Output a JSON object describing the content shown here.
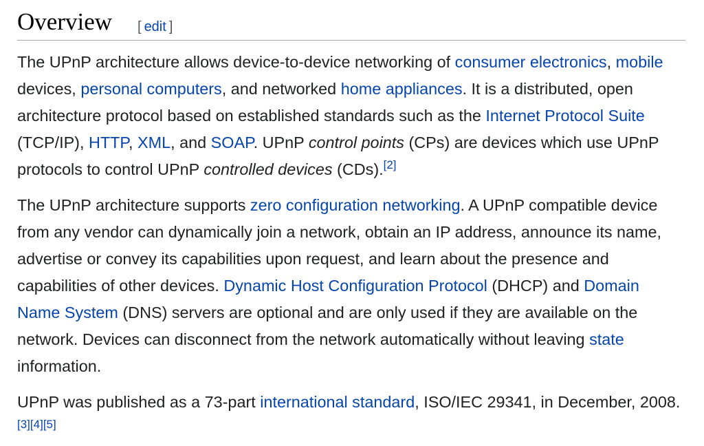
{
  "section": {
    "title": "Overview",
    "edit_bracket_open": "[",
    "edit_label": "edit",
    "edit_bracket_close": "]"
  },
  "paragraphs": {
    "p1": {
      "t1": "The UPnP architecture allows device-to-device networking of ",
      "l1": "consumer electronics",
      "t2": ", ",
      "l2": "mobile",
      "t3": " devices, ",
      "l3": "personal computers",
      "t4": ", and networked ",
      "l4": "home appliances",
      "t5": ". It is a distributed, open architecture protocol based on established standards such as the ",
      "l5": "Internet Protocol Suite",
      "t6": " (TCP/IP), ",
      "l6": "HTTP",
      "t7": ", ",
      "l7": "XML",
      "t8": ", and ",
      "l8": "SOAP",
      "t9": ". UPnP ",
      "i1": "control points",
      "t10": " (CPs) are devices which use UPnP protocols to control UPnP ",
      "i2": "controlled devices",
      "t11": " (CDs).",
      "ref1": "[2]"
    },
    "p2": {
      "t1": "The UPnP architecture supports ",
      "l1": "zero configuration networking",
      "t2": ". A UPnP compatible device from any vendor can dynamically join a network, obtain an IP address, announce its name, advertise or convey its capabilities upon request, and learn about the presence and capabilities of other devices. ",
      "l2": "Dynamic Host Configuration Protocol",
      "t3": " (DHCP) and ",
      "l3": "Domain Name System",
      "t4": " (DNS) servers are optional and are only used if they are available on the network. Devices can disconnect from the network automatically without leaving ",
      "l4": "state",
      "t5": " information."
    },
    "p3": {
      "t1": "UPnP was published as a 73-part ",
      "l1": "international standard",
      "t2": ", ISO/IEC 29341, in December, 2008.",
      "ref1": "[3]",
      "ref2": "[4]",
      "ref3": "[5]"
    }
  },
  "colors": {
    "link": "#0645ad",
    "text": "#202122",
    "heading": "#000000",
    "rule": "#a2a9b1"
  }
}
